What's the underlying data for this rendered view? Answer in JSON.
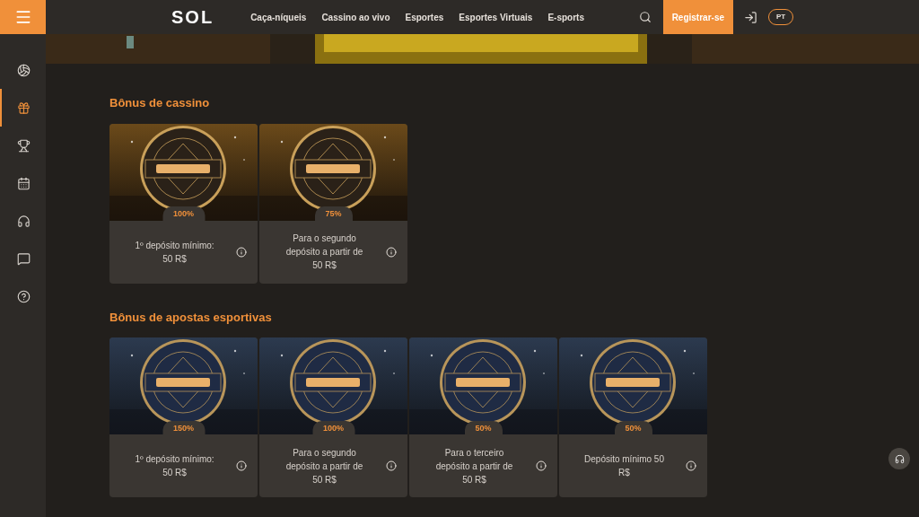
{
  "header": {
    "logo": "SOL",
    "nav": [
      "Caça-níqueis",
      "Cassino ao vivo",
      "Esportes",
      "Esportes Virtuais",
      "E-sports"
    ],
    "register": "Registrar-se",
    "language": "PT"
  },
  "sidebar": {
    "items": [
      {
        "selected": false
      },
      {
        "selected": true
      },
      {
        "selected": false
      },
      {
        "selected": false
      },
      {
        "selected": false
      },
      {
        "selected": false
      },
      {
        "selected": false
      }
    ]
  },
  "sections": [
    {
      "title": "Bônus de cassino",
      "kind": "casino",
      "cards": [
        {
          "percent": "100%",
          "description": "1º depósito mínimo: 50 R$"
        },
        {
          "percent": "75%",
          "description": "Para o segundo depósito a partir de 50 R$"
        }
      ]
    },
    {
      "title": "Bônus de apostas esportivas",
      "kind": "sports",
      "cards": [
        {
          "percent": "150%",
          "description": "1º depósito mínimo: 50 R$"
        },
        {
          "percent": "100%",
          "description": "Para o segundo depósito a partir de 50 R$"
        },
        {
          "percent": "50%",
          "description": "Para o terceiro depósito a partir de 50 R$"
        },
        {
          "percent": "50%",
          "description": "Depósito mínimo 50 R$"
        }
      ]
    }
  ]
}
